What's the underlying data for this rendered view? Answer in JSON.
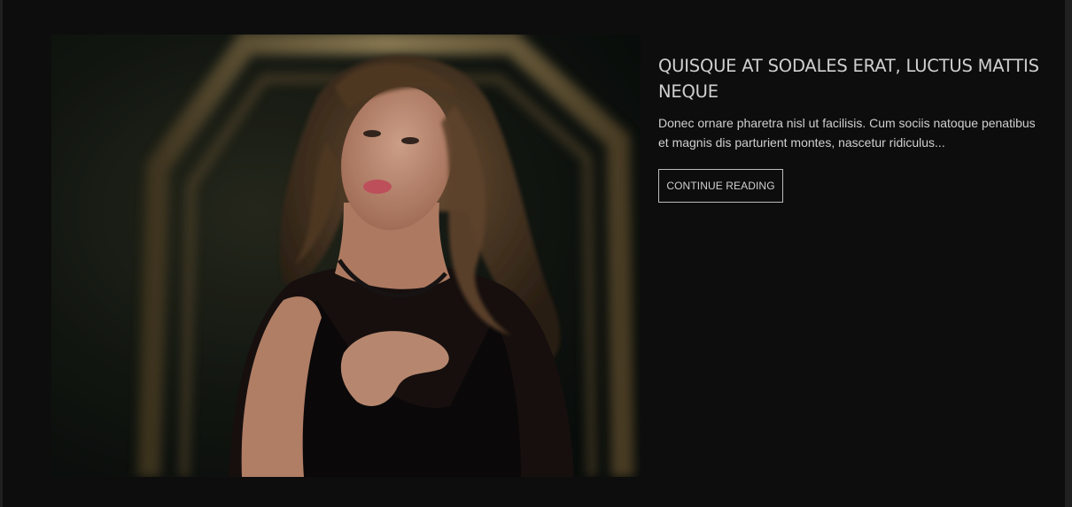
{
  "post": {
    "title": "QUISQUE AT SODALES ERAT, LUCTUS MATTIS NEQUE",
    "excerpt": "Donec ornare pharetra nisl ut facilisis. Cum sociis natoque penatibus et magnis dis parturient montes, nascetur ridiculus...",
    "read_more_label": "CONTINUE READING",
    "image_icon": "portrait-photo"
  },
  "colors": {
    "page_background": "#0d0d0d",
    "outer_background": "#202020",
    "title_text": "#cfcfcf",
    "button_border": "#bdbdbd"
  }
}
